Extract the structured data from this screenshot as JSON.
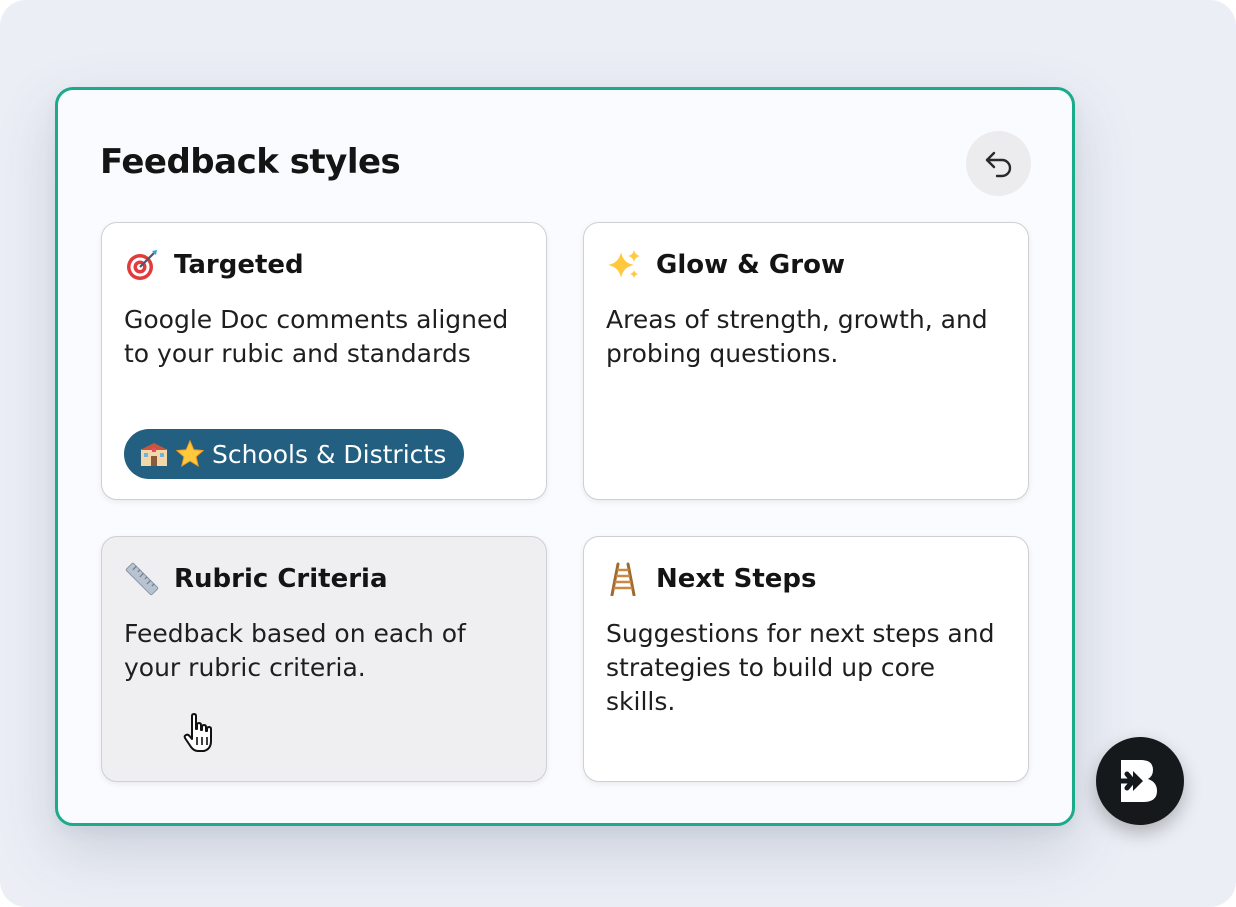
{
  "panel": {
    "title": "Feedback styles"
  },
  "cards": [
    {
      "icon": "target-icon",
      "title": "Targeted",
      "description": "Google Doc comments aligned to your rubic and standards",
      "badge": {
        "icons": [
          "school-icon",
          "star-icon"
        ],
        "label": "Schools & Districts"
      }
    },
    {
      "icon": "sparkles-icon",
      "title": "Glow & Grow",
      "description": "Areas of strength, growth, and probing questions."
    },
    {
      "icon": "ruler-icon",
      "title": "Rubric Criteria",
      "description": "Feedback based on each of your rubric criteria."
    },
    {
      "icon": "ladder-icon",
      "title": "Next Steps",
      "description": "Suggestions for next steps and strategies to build up core skills."
    }
  ],
  "back_button": {
    "icon": "undo-arrow-icon"
  },
  "brand_logo": {
    "icon": "brand-b-logo-icon"
  },
  "colors": {
    "accent_border": "#1aab8a",
    "badge_bg": "#235f80",
    "page_bg": "#ebeef5",
    "hover_card_bg": "#efeff1"
  }
}
